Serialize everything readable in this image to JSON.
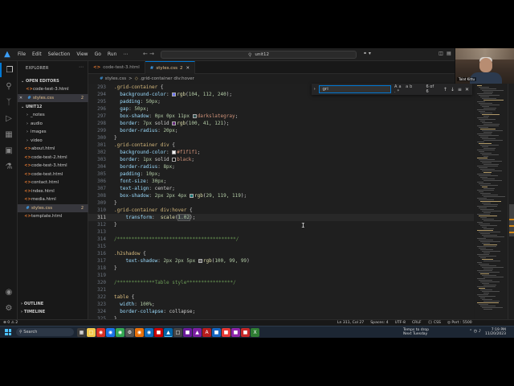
{
  "titlebar": {
    "menu": [
      "File",
      "Edit",
      "Selection",
      "View",
      "Go",
      "Run"
    ],
    "search": "unit12",
    "more": "⋯"
  },
  "webcam": {
    "name": "Talat Kittu"
  },
  "explorer": {
    "title": "EXPLORER",
    "open_editors_label": "OPEN EDITORS",
    "open_editors": [
      {
        "name": "code-test-3.html",
        "type": "html",
        "badge": ""
      },
      {
        "name": "styles.css",
        "type": "css",
        "badge": "2"
      }
    ],
    "folder_label": "UNIT12",
    "items": [
      {
        "name": "_notes",
        "type": "folder",
        "badge": ""
      },
      {
        "name": "audio",
        "type": "folder",
        "badge": ""
      },
      {
        "name": "images",
        "type": "folder",
        "badge": ""
      },
      {
        "name": "video",
        "type": "folder",
        "badge": ""
      },
      {
        "name": "about.html",
        "type": "html",
        "badge": ""
      },
      {
        "name": "code-test-2.html",
        "type": "html",
        "badge": ""
      },
      {
        "name": "code-test-3.html",
        "type": "html",
        "badge": ""
      },
      {
        "name": "code-test.html",
        "type": "html",
        "badge": ""
      },
      {
        "name": "contact.html",
        "type": "html",
        "badge": ""
      },
      {
        "name": "index.html",
        "type": "html",
        "badge": ""
      },
      {
        "name": "media.html",
        "type": "html",
        "badge": ""
      },
      {
        "name": "styles.css",
        "type": "css",
        "badge": "2"
      },
      {
        "name": "template.html",
        "type": "html",
        "badge": ""
      }
    ],
    "outline_label": "OUTLINE",
    "timeline_label": "TIMELINE"
  },
  "tabs": [
    {
      "label": "code-test-3.html",
      "type": "html",
      "active": false,
      "badge": ""
    },
    {
      "label": "styles.css",
      "type": "css",
      "active": true,
      "badge": "2"
    }
  ],
  "breadcrumb": {
    "file": "styles.css",
    "sep": ">",
    "selector": ".grid-container div:hover"
  },
  "find": {
    "query": "gri",
    "count": "6 of 6",
    "options": "Aa ab .*"
  },
  "code_lines": [
    {
      "n": "293",
      "text": ".grid-container {"
    },
    {
      "n": "294",
      "text": "  background-color: rgb(104, 112, 240);"
    },
    {
      "n": "295",
      "text": "  padding: 50px;"
    },
    {
      "n": "296",
      "text": "  gap: 50px;"
    },
    {
      "n": "297",
      "text": "  box-shadow: 0px 0px 11px darkslategray;"
    },
    {
      "n": "298",
      "text": "  border: 7px solid rgb(100, 41, 121);"
    },
    {
      "n": "299",
      "text": "  border-radius: 20px;"
    },
    {
      "n": "300",
      "text": "}"
    },
    {
      "n": "301",
      "text": ".grid-container div {"
    },
    {
      "n": "302",
      "text": "  background-color: #f1f1f1;"
    },
    {
      "n": "303",
      "text": "  border: 1px solid black;"
    },
    {
      "n": "304",
      "text": "  border-radius: 8px;"
    },
    {
      "n": "305",
      "text": "  padding: 10px;"
    },
    {
      "n": "306",
      "text": "  font-size: 30px;"
    },
    {
      "n": "307",
      "text": "  text-align: center;"
    },
    {
      "n": "308",
      "text": "  box-shadow: 2px 2px 4px rgb(29, 119, 119);"
    },
    {
      "n": "309",
      "text": "}"
    },
    {
      "n": "310",
      "text": ".grid-container div:hover {"
    },
    {
      "n": "311",
      "text": "    transform:  scale(1.02);"
    },
    {
      "n": "312",
      "text": "}"
    },
    {
      "n": "313",
      "text": ""
    },
    {
      "n": "314",
      "text": "/*****************************************/"
    },
    {
      "n": "315",
      "text": ""
    },
    {
      "n": "316",
      "text": ".h2shadow {"
    },
    {
      "n": "317",
      "text": "    text-shadow: 2px 2px 5px rgb(100, 99, 99)"
    },
    {
      "n": "318",
      "text": "}"
    },
    {
      "n": "319",
      "text": ""
    },
    {
      "n": "320",
      "text": "/*************Table style****************/"
    },
    {
      "n": "321",
      "text": ""
    },
    {
      "n": "322",
      "text": "table {"
    },
    {
      "n": "323",
      "text": "  width: 100%;"
    },
    {
      "n": "324",
      "text": "  border-collapse: collapse;"
    },
    {
      "n": "325",
      "text": "}"
    }
  ],
  "status": {
    "left": "⊗ 0 ⚠ 2",
    "items": [
      "Ln 311, Col 27",
      "Spaces: 4",
      "UTF-8",
      "CRLF",
      "{} CSS",
      "◎ Port : 5500"
    ]
  },
  "taskbar": {
    "search": "Search",
    "weather_line1": "Temps to drop",
    "weather_line2": "Next Tuesday",
    "time": "7:19 PM",
    "date": "11/20/2023"
  },
  "colors": {
    "accent": "#0078d4",
    "swatch_1": "#6870f0",
    "swatch_2": "#2f4f4f",
    "swatch_3": "#642979",
    "swatch_4": "#f1f1f1",
    "swatch_5": "#000000",
    "swatch_6": "#1d7777",
    "swatch_7": "#646363"
  }
}
